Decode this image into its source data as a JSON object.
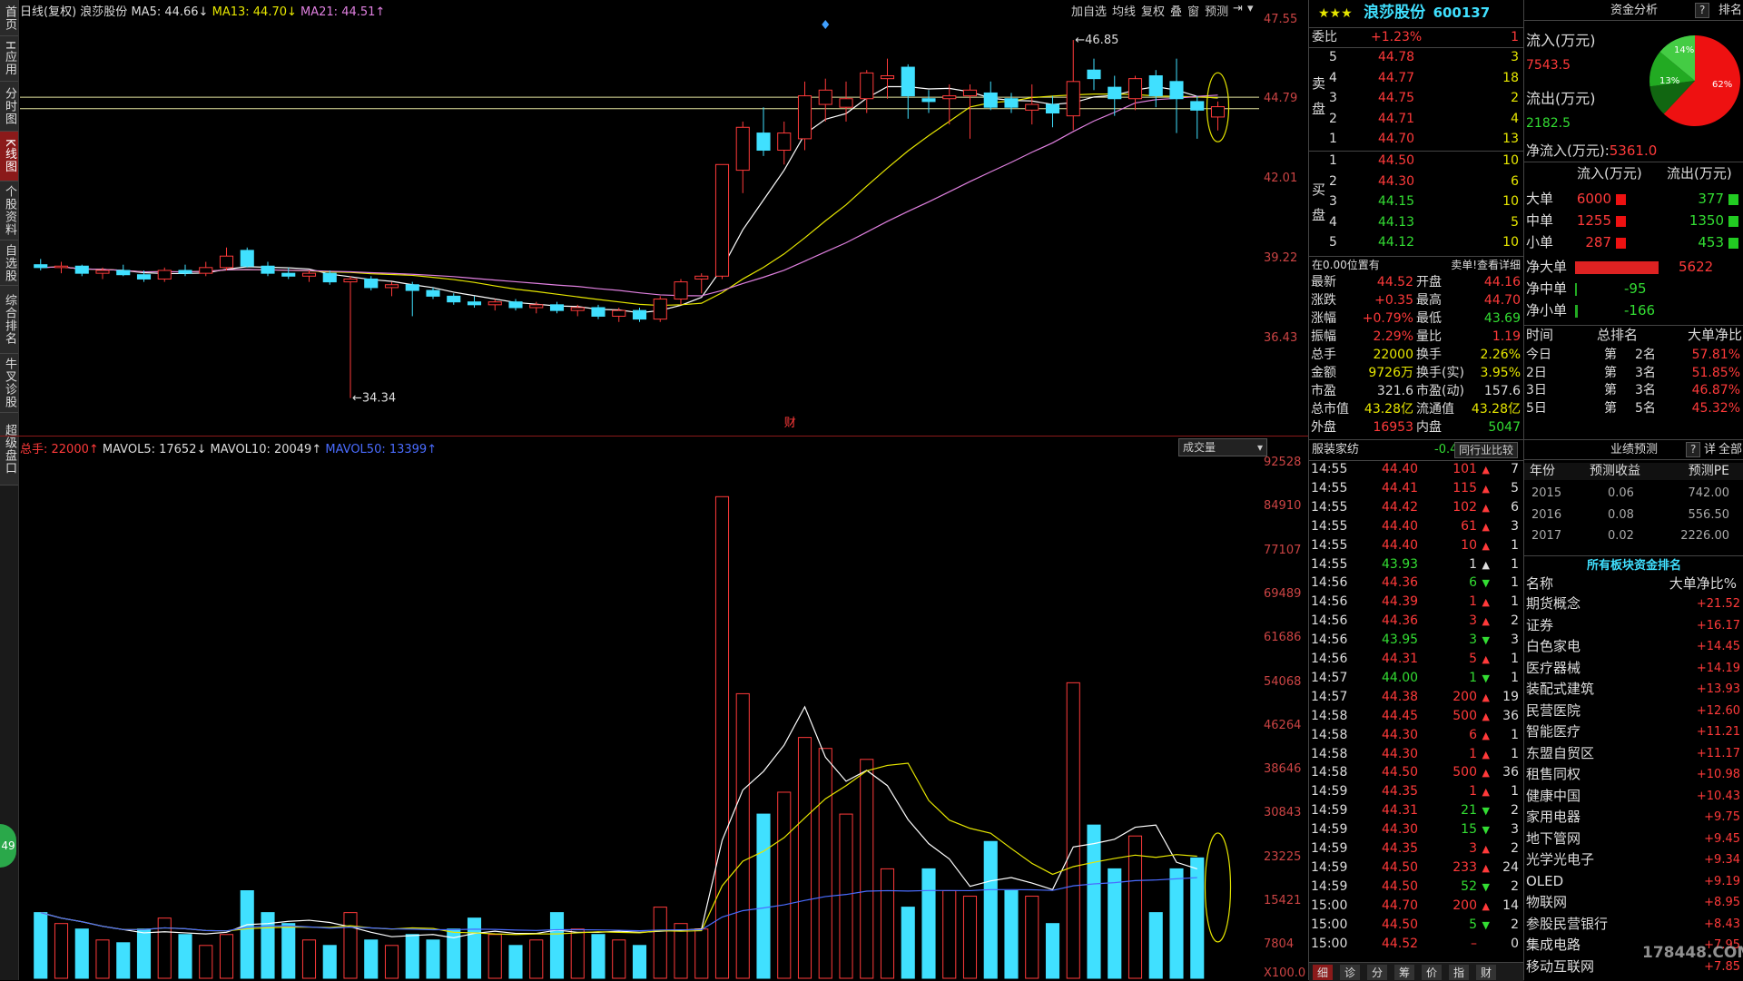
{
  "left_tabs": [
    "首页",
    "H应用",
    "分时图",
    "K线图",
    "个股资料",
    "自选股",
    "综合排名",
    "牛叉诊股",
    "超级盘口"
  ],
  "active_tab": "K线图",
  "kline_header": {
    "mode": "日线(复权)",
    "stock": "浪莎股份",
    "ma5": "MA5: 44.66↓",
    "ma13": "MA13: 44.70↓",
    "ma21": "MA21: 44.51↑"
  },
  "toolbar": [
    "加自选",
    "均线",
    "复权",
    "叠",
    "窗",
    "预测"
  ],
  "price_axis": [
    "47.55",
    "44.79",
    "42.01",
    "39.22",
    "36.43"
  ],
  "annot_high": "46.85",
  "annot_low": "34.34",
  "fin_marker": "财",
  "vol_header": {
    "total": "总手: 22000↑",
    "mavol5": "MAVOL5: 17652↓",
    "mavol10": "MAVOL10: 20049↑",
    "mavol50": "MAVOL50: 13399↑",
    "dropdown": "成交量"
  },
  "vol_axis": [
    "92528",
    "84910",
    "77107",
    "69489",
    "61686",
    "54068",
    "46264",
    "38646",
    "30843",
    "23225",
    "15421",
    "7804",
    "X100.0"
  ],
  "badge": "49",
  "quote": {
    "stars": "★★★",
    "name": "浪莎股份",
    "code": "600137",
    "weibi_label": "委比",
    "weibi_value": "+1.23%",
    "weibi_diff": "1",
    "sell_label": "卖盘",
    "buy_label": "买盘",
    "asks": [
      {
        "lv": "5",
        "price": "44.78",
        "vol": "3"
      },
      {
        "lv": "4",
        "price": "44.77",
        "vol": "18"
      },
      {
        "lv": "3",
        "price": "44.75",
        "vol": "2"
      },
      {
        "lv": "2",
        "price": "44.71",
        "vol": "4"
      },
      {
        "lv": "1",
        "price": "44.70",
        "vol": "13"
      }
    ],
    "bids": [
      {
        "lv": "1",
        "price": "44.50",
        "vol": "10"
      },
      {
        "lv": "2",
        "price": "44.30",
        "vol": "6"
      },
      {
        "lv": "3",
        "price": "44.15",
        "vol": "10"
      },
      {
        "lv": "4",
        "price": "44.13",
        "vol": "5"
      },
      {
        "lv": "5",
        "price": "44.12",
        "vol": "10"
      }
    ],
    "pos_text": "在0.00位置有",
    "detail_link": "卖单!查看详细",
    "stats": [
      {
        "l1": "最新",
        "v1": "44.52",
        "l2": "开盘",
        "v2": "44.16",
        "c1": "red",
        "c2": "red"
      },
      {
        "l1": "涨跌",
        "v1": "+0.35",
        "l2": "最高",
        "v2": "44.70",
        "c1": "red",
        "c2": "red"
      },
      {
        "l1": "涨幅",
        "v1": "+0.79%",
        "l2": "最低",
        "v2": "43.69",
        "c1": "red",
        "c2": "green"
      },
      {
        "l1": "振幅",
        "v1": "2.29%",
        "l2": "量比",
        "v2": "1.19",
        "c1": "red",
        "c2": "red"
      },
      {
        "l1": "总手",
        "v1": "22000",
        "l2": "换手",
        "v2": "2.26%",
        "c1": "yellow",
        "c2": "yellow"
      },
      {
        "l1": "金额",
        "v1": "9726万",
        "l2": "换手(实)",
        "v2": "3.95%",
        "c1": "yellow",
        "c2": "yellow"
      },
      {
        "l1": "市盈",
        "v1": "321.6",
        "l2": "市盈(动)",
        "v2": "157.6",
        "c1": "white",
        "c2": "white"
      },
      {
        "l1": "总市值",
        "v1": "43.28亿",
        "l2": "流通值",
        "v2": "43.28亿",
        "c1": "yellow",
        "c2": "yellow"
      },
      {
        "l1": "外盘",
        "v1": "16953",
        "l2": "内盘",
        "v2": "5047",
        "c1": "red",
        "c2": "green"
      }
    ],
    "sector_name": "服装家纺",
    "sector_change": "-0.44%",
    "compare_btn": "同行业比较"
  },
  "ticks": [
    {
      "t": "14:55",
      "p": "44.40",
      "v": "101",
      "d": "up",
      "n": "7",
      "pc": "red"
    },
    {
      "t": "14:55",
      "p": "44.41",
      "v": "115",
      "d": "up",
      "n": "5",
      "pc": "red"
    },
    {
      "t": "14:55",
      "p": "44.42",
      "v": "102",
      "d": "up",
      "n": "6",
      "pc": "red"
    },
    {
      "t": "14:55",
      "p": "44.40",
      "v": "61",
      "d": "up",
      "n": "3",
      "pc": "red"
    },
    {
      "t": "14:55",
      "p": "44.40",
      "v": "10",
      "d": "up",
      "n": "1",
      "pc": "red"
    },
    {
      "t": "14:55",
      "p": "43.93",
      "v": "1",
      "d": "wup",
      "n": "1",
      "pc": "green"
    },
    {
      "t": "14:56",
      "p": "44.36",
      "v": "6",
      "d": "down",
      "n": "1",
      "pc": "red"
    },
    {
      "t": "14:56",
      "p": "44.39",
      "v": "1",
      "d": "up",
      "n": "1",
      "pc": "red"
    },
    {
      "t": "14:56",
      "p": "44.36",
      "v": "3",
      "d": "up",
      "n": "2",
      "pc": "red"
    },
    {
      "t": "14:56",
      "p": "43.95",
      "v": "3",
      "d": "down",
      "n": "3",
      "pc": "green"
    },
    {
      "t": "14:56",
      "p": "44.31",
      "v": "5",
      "d": "up",
      "n": "1",
      "pc": "red"
    },
    {
      "t": "14:57",
      "p": "44.00",
      "v": "1",
      "d": "down",
      "n": "1",
      "pc": "green"
    },
    {
      "t": "14:57",
      "p": "44.38",
      "v": "200",
      "d": "up",
      "n": "19",
      "pc": "red"
    },
    {
      "t": "14:58",
      "p": "44.45",
      "v": "500",
      "d": "up",
      "n": "36",
      "pc": "red"
    },
    {
      "t": "14:58",
      "p": "44.30",
      "v": "6",
      "d": "up",
      "n": "1",
      "pc": "red"
    },
    {
      "t": "14:58",
      "p": "44.30",
      "v": "1",
      "d": "up",
      "n": "1",
      "pc": "red"
    },
    {
      "t": "14:58",
      "p": "44.50",
      "v": "500",
      "d": "up",
      "n": "36",
      "pc": "red"
    },
    {
      "t": "14:59",
      "p": "44.35",
      "v": "1",
      "d": "up",
      "n": "1",
      "pc": "red"
    },
    {
      "t": "14:59",
      "p": "44.31",
      "v": "21",
      "d": "down",
      "n": "2",
      "pc": "red"
    },
    {
      "t": "14:59",
      "p": "44.30",
      "v": "15",
      "d": "down",
      "n": "3",
      "pc": "red"
    },
    {
      "t": "14:59",
      "p": "44.35",
      "v": "3",
      "d": "up",
      "n": "2",
      "pc": "red"
    },
    {
      "t": "14:59",
      "p": "44.50",
      "v": "233",
      "d": "up",
      "n": "24",
      "pc": "red"
    },
    {
      "t": "14:59",
      "p": "44.50",
      "v": "52",
      "d": "down",
      "n": "2",
      "pc": "red"
    },
    {
      "t": "15:00",
      "p": "44.70",
      "v": "200",
      "d": "up",
      "n": "14",
      "pc": "red"
    },
    {
      "t": "15:00",
      "p": "44.50",
      "v": "5",
      "d": "down",
      "n": "2",
      "pc": "red"
    },
    {
      "t": "15:00",
      "p": "44.52",
      "v": "–",
      "d": "none",
      "n": "0",
      "pc": "red"
    }
  ],
  "bottom_tabs": [
    "细",
    "诊",
    "分",
    "筹",
    "价",
    "指",
    "财"
  ],
  "funds": {
    "title": "资金分析",
    "help": "?",
    "rank_btn": "排名",
    "inflow_label": "流入(万元)",
    "inflow_value": "7543.5",
    "outflow_label": "流出(万元)",
    "outflow_value": "2182.5",
    "net_label": "净流入(万元):",
    "net_value": "5361.0",
    "pie": {
      "red": 62,
      "green_big": 14,
      "green_mid": 13,
      "labels": [
        "14%",
        "13%",
        "62%"
      ]
    },
    "col_in": "流入(万元)",
    "col_out": "流出(万元)",
    "orders": [
      {
        "name": "大单",
        "in": "6000",
        "out": "377"
      },
      {
        "name": "中单",
        "in": "1255",
        "out": "1350"
      },
      {
        "name": "小单",
        "in": "287",
        "out": "453"
      }
    ],
    "net_orders": [
      {
        "name": "净大单",
        "value": "5622",
        "c": "red",
        "frac": 0.85
      },
      {
        "name": "净中单",
        "value": "-95",
        "c": "green",
        "frac": 0.02
      },
      {
        "name": "净小单",
        "value": "-166",
        "c": "green",
        "frac": 0.03
      }
    ],
    "rank_head": [
      "时间",
      "总排名",
      "大单净比"
    ],
    "ranks": [
      {
        "t": "今日",
        "prefix": "第",
        "n": "2名",
        "pct": "57.81%"
      },
      {
        "t": "2日",
        "prefix": "第",
        "n": "3名",
        "pct": "51.85%"
      },
      {
        "t": "3日",
        "prefix": "第",
        "n": "3名",
        "pct": "46.87%"
      },
      {
        "t": "5日",
        "prefix": "第",
        "n": "5名",
        "pct": "45.32%"
      }
    ],
    "forecast_title": "业绩预测",
    "forecast_q": "?",
    "forecast_detail": "详",
    "forecast_all": "全部",
    "forecast_head": [
      "年份",
      "预测收益",
      "预测PE"
    ],
    "forecast": [
      {
        "y": "2015",
        "eps": "0.06",
        "pe": "742.00"
      },
      {
        "y": "2016",
        "eps": "0.08",
        "pe": "556.50"
      },
      {
        "y": "2017",
        "eps": "0.02",
        "pe": "2226.00"
      }
    ],
    "sector_title": "所有板块资金排名",
    "sector_head": [
      "名称",
      "大单净比%"
    ],
    "sectors": [
      {
        "n": "期货概念",
        "v": "+21.52"
      },
      {
        "n": "证券",
        "v": "+16.17"
      },
      {
        "n": "白色家电",
        "v": "+14.45"
      },
      {
        "n": "医疗器械",
        "v": "+14.19"
      },
      {
        "n": "装配式建筑",
        "v": "+13.93"
      },
      {
        "n": "民营医院",
        "v": "+12.60"
      },
      {
        "n": "智能医疗",
        "v": "+11.21"
      },
      {
        "n": "东盟自贸区",
        "v": "+11.17"
      },
      {
        "n": "租售同权",
        "v": "+10.98"
      },
      {
        "n": "健康中国",
        "v": "+10.43"
      },
      {
        "n": "家用电器",
        "v": "+9.75"
      },
      {
        "n": "地下管网",
        "v": "+9.45"
      },
      {
        "n": "光学光电子",
        "v": "+9.34"
      },
      {
        "n": "OLED",
        "v": "+9.19"
      },
      {
        "n": "物联网",
        "v": "+8.95"
      },
      {
        "n": "参股民营银行",
        "v": "+8.43"
      },
      {
        "n": "集成电路",
        "v": "+7.95"
      },
      {
        "n": "移动互联网",
        "v": "+7.85"
      }
    ]
  },
  "watermark": "178448.COM",
  "candles": [
    {
      "o": 39.0,
      "h": 39.2,
      "l": 38.8,
      "c": 38.9
    },
    {
      "o": 38.9,
      "h": 39.1,
      "l": 38.7,
      "c": 38.95
    },
    {
      "o": 38.95,
      "h": 39.0,
      "l": 38.6,
      "c": 38.7
    },
    {
      "o": 38.7,
      "h": 38.9,
      "l": 38.5,
      "c": 38.8
    },
    {
      "o": 38.8,
      "h": 39.0,
      "l": 38.6,
      "c": 38.65
    },
    {
      "o": 38.65,
      "h": 38.8,
      "l": 38.4,
      "c": 38.5
    },
    {
      "o": 38.5,
      "h": 38.9,
      "l": 38.4,
      "c": 38.8
    },
    {
      "o": 38.8,
      "h": 39.0,
      "l": 38.6,
      "c": 38.7
    },
    {
      "o": 38.7,
      "h": 39.1,
      "l": 38.6,
      "c": 38.9
    },
    {
      "o": 38.9,
      "h": 39.6,
      "l": 38.8,
      "c": 39.3
    },
    {
      "o": 39.5,
      "h": 39.6,
      "l": 38.9,
      "c": 38.95
    },
    {
      "o": 38.95,
      "h": 39.1,
      "l": 38.6,
      "c": 38.7
    },
    {
      "o": 38.7,
      "h": 38.9,
      "l": 38.5,
      "c": 38.6
    },
    {
      "o": 38.6,
      "h": 38.8,
      "l": 38.4,
      "c": 38.7
    },
    {
      "o": 38.7,
      "h": 38.8,
      "l": 38.3,
      "c": 38.4
    },
    {
      "o": 38.4,
      "h": 38.6,
      "l": 34.34,
      "c": 38.5
    },
    {
      "o": 38.5,
      "h": 38.6,
      "l": 38.1,
      "c": 38.2
    },
    {
      "o": 38.2,
      "h": 38.4,
      "l": 37.9,
      "c": 38.3
    },
    {
      "o": 38.3,
      "h": 38.4,
      "l": 37.2,
      "c": 38.1
    },
    {
      "o": 38.1,
      "h": 38.2,
      "l": 37.8,
      "c": 37.9
    },
    {
      "o": 37.9,
      "h": 38.0,
      "l": 37.6,
      "c": 37.7
    },
    {
      "o": 37.7,
      "h": 37.9,
      "l": 37.5,
      "c": 37.6
    },
    {
      "o": 37.6,
      "h": 37.8,
      "l": 37.4,
      "c": 37.7
    },
    {
      "o": 37.7,
      "h": 37.8,
      "l": 37.4,
      "c": 37.5
    },
    {
      "o": 37.5,
      "h": 37.7,
      "l": 37.3,
      "c": 37.6
    },
    {
      "o": 37.6,
      "h": 37.7,
      "l": 37.3,
      "c": 37.4
    },
    {
      "o": 37.4,
      "h": 37.6,
      "l": 37.2,
      "c": 37.5
    },
    {
      "o": 37.5,
      "h": 37.6,
      "l": 37.1,
      "c": 37.2
    },
    {
      "o": 37.2,
      "h": 37.5,
      "l": 37.0,
      "c": 37.4
    },
    {
      "o": 37.4,
      "h": 37.5,
      "l": 37.0,
      "c": 37.1
    },
    {
      "o": 37.1,
      "h": 37.9,
      "l": 37.0,
      "c": 37.8
    },
    {
      "o": 37.8,
      "h": 38.5,
      "l": 37.6,
      "c": 38.4
    },
    {
      "o": 38.5,
      "h": 38.7,
      "l": 38.0,
      "c": 38.6
    },
    {
      "o": 38.6,
      "h": 42.5,
      "l": 38.5,
      "c": 42.5
    },
    {
      "o": 42.3,
      "h": 44.0,
      "l": 41.5,
      "c": 43.8
    },
    {
      "o": 43.6,
      "h": 44.5,
      "l": 42.8,
      "c": 43.0
    },
    {
      "o": 43.0,
      "h": 44.0,
      "l": 42.5,
      "c": 43.6
    },
    {
      "o": 43.4,
      "h": 45.4,
      "l": 43.0,
      "c": 44.9
    },
    {
      "o": 44.6,
      "h": 45.5,
      "l": 44.0,
      "c": 45.1
    },
    {
      "o": 44.5,
      "h": 45.4,
      "l": 44.0,
      "c": 44.8
    },
    {
      "o": 44.8,
      "h": 45.8,
      "l": 44.3,
      "c": 45.7
    },
    {
      "o": 45.5,
      "h": 46.2,
      "l": 44.8,
      "c": 45.6
    },
    {
      "o": 45.9,
      "h": 46.0,
      "l": 44.1,
      "c": 44.9
    },
    {
      "o": 44.8,
      "h": 45.1,
      "l": 44.3,
      "c": 44.7
    },
    {
      "o": 44.8,
      "h": 45.3,
      "l": 43.9,
      "c": 44.9
    },
    {
      "o": 44.9,
      "h": 45.3,
      "l": 43.4,
      "c": 45.1
    },
    {
      "o": 45.0,
      "h": 45.4,
      "l": 44.4,
      "c": 44.5
    },
    {
      "o": 44.8,
      "h": 45.0,
      "l": 44.3,
      "c": 44.5
    },
    {
      "o": 44.4,
      "h": 45.3,
      "l": 43.9,
      "c": 44.6
    },
    {
      "o": 44.6,
      "h": 44.9,
      "l": 43.8,
      "c": 44.3
    },
    {
      "o": 44.2,
      "h": 46.85,
      "l": 43.7,
      "c": 45.4
    },
    {
      "o": 45.8,
      "h": 46.2,
      "l": 45.1,
      "c": 45.5
    },
    {
      "o": 45.2,
      "h": 45.6,
      "l": 44.2,
      "c": 44.8
    },
    {
      "o": 44.8,
      "h": 45.6,
      "l": 44.4,
      "c": 45.5
    },
    {
      "o": 45.6,
      "h": 45.8,
      "l": 44.5,
      "c": 44.9
    },
    {
      "o": 45.4,
      "h": 46.2,
      "l": 43.6,
      "c": 44.8
    },
    {
      "o": 44.7,
      "h": 44.9,
      "l": 43.4,
      "c": 44.4
    },
    {
      "o": 44.16,
      "h": 44.7,
      "l": 43.69,
      "c": 44.52
    }
  ],
  "volumes": [
    12000,
    10000,
    9000,
    7000,
    6500,
    9000,
    11000,
    8000,
    6000,
    8000,
    16000,
    12000,
    10000,
    7000,
    6000,
    12000,
    7000,
    6000,
    8000,
    7000,
    9000,
    11000,
    8000,
    6000,
    7000,
    12000,
    9000,
    8000,
    7000,
    6000,
    13000,
    10000,
    9000,
    88000,
    52000,
    30000,
    34000,
    44000,
    42000,
    30000,
    40000,
    20000,
    13000,
    20000,
    16000,
    15000,
    25000,
    16000,
    15000,
    10000,
    54000,
    28000,
    20000,
    26000,
    12000,
    20000,
    22000
  ]
}
